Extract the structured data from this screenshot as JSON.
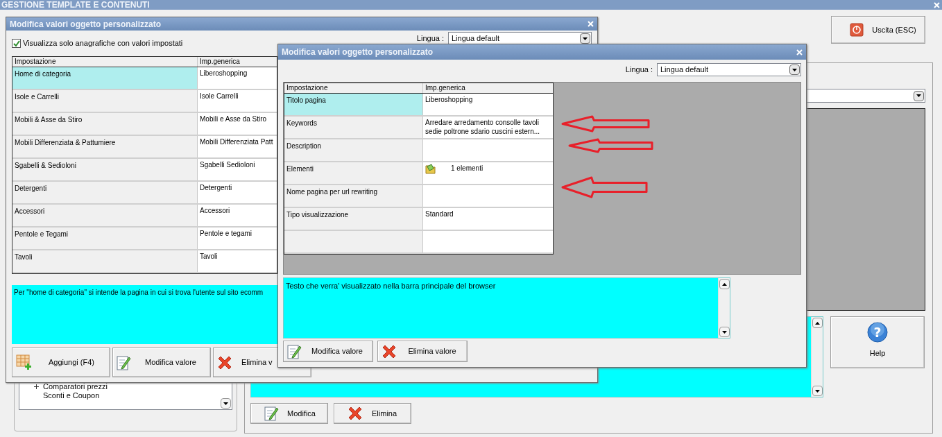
{
  "app": {
    "title": "GESTIONE TEMPLATE E CONTENUTI"
  },
  "exit_button": {
    "label": "Uscita (ESC)",
    "kind": "exit"
  },
  "help_button": {
    "label": "Help",
    "kind": "help",
    "glyph": "?"
  },
  "tree": [
    {
      "label": "Comparatori prezzi",
      "kind": "group"
    },
    {
      "label": "Sconti e Coupon",
      "kind": "leaf"
    }
  ],
  "main_buttons": [
    {
      "label": "Modifica",
      "kind": "edit"
    },
    {
      "label": "Elimina",
      "kind": "delete"
    }
  ],
  "dialogs": [
    {
      "title": "Modifica valori oggetto personalizzato",
      "checkbox": {
        "label": "Visualizza solo anagrafiche con valori impostati",
        "checked": true
      },
      "language": {
        "label": "Lingua :",
        "value": "Lingua default"
      },
      "table": {
        "columns": [
          "Impostazione",
          "Imp.generica"
        ],
        "rows": [
          {
            "setting": "Home di categoria",
            "value": "Liberoshopping",
            "selected": true,
            "kind": "text"
          },
          {
            "setting": "Isole e Carrelli",
            "value": "Isole Carrelli",
            "selected": false,
            "kind": "text"
          },
          {
            "setting": "Mobili & Asse da Stiro",
            "value": "Mobili e Asse da Stiro",
            "selected": false,
            "kind": "text"
          },
          {
            "setting": "Mobili Differenziata & Pattumiere",
            "value": "Mobili Differenziata Patt",
            "selected": false,
            "kind": "text"
          },
          {
            "setting": "Sgabelli & Sedioloni",
            "value": "Sgabelli Sedioloni",
            "selected": false,
            "kind": "text"
          },
          {
            "setting": "Detergenti",
            "value": "Detergenti",
            "selected": false,
            "kind": "text"
          },
          {
            "setting": "Accessori",
            "value": "Accessori",
            "selected": false,
            "kind": "text"
          },
          {
            "setting": "Pentole e Tegami",
            "value": "Pentole e tegami",
            "selected": false,
            "kind": "text"
          },
          {
            "setting": "Tavoli",
            "value": "Tavoli",
            "selected": false,
            "kind": "text"
          }
        ]
      },
      "description": "Per \"home di categoria\" si intende la pagina in cui si trova l'utente sul sito ecomm",
      "buttons": [
        {
          "label": "Aggiungi (F4)",
          "kind": "add"
        },
        {
          "label": "Modifica valore",
          "kind": "edit"
        },
        {
          "label": "Elimina v",
          "kind": "delete"
        }
      ]
    },
    {
      "title": "Modifica valori oggetto personalizzato",
      "language": {
        "label": "Lingua :",
        "value": "Lingua default"
      },
      "table": {
        "columns": [
          "Impostazione",
          "Imp.generica"
        ],
        "rows": [
          {
            "setting": "Titolo pagina",
            "value": "Liberoshopping",
            "selected": true,
            "kind": "text"
          },
          {
            "setting": "Keywords",
            "value": "Arredare arredamento consolle tavoli sedie poltrone sdario cuscini estern...",
            "selected": false,
            "kind": "text"
          },
          {
            "setting": "Description",
            "selected": false,
            "kind": "text"
          },
          {
            "setting": "Elementi",
            "value": "1 elementi",
            "selected": false,
            "kind": "elements"
          },
          {
            "setting": "Nome pagina per url rewriting",
            "selected": false,
            "kind": "text"
          },
          {
            "setting": "Tipo visualizzazione",
            "value": "Standard",
            "selected": false,
            "kind": "text"
          },
          {
            "selected": false,
            "kind": "text"
          }
        ]
      },
      "description": "Testo che verra' visualizzato nella barra principale del browser",
      "buttons": [
        {
          "label": "Modifica valore",
          "kind": "edit"
        },
        {
          "label": "Elimina valore",
          "kind": "delete"
        }
      ]
    }
  ]
}
